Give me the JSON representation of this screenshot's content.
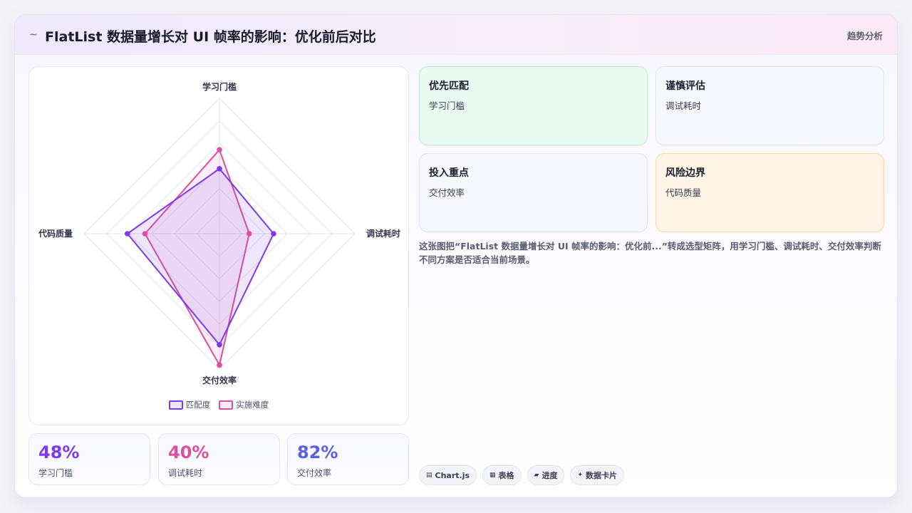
{
  "header": {
    "logo_icon": "~",
    "title": "FlatList 数据量增长对 UI 帧率的影响：优化前后对比",
    "tag": "趋势分析"
  },
  "chart_data": {
    "type": "radar",
    "axes": [
      "学习门槛",
      "调试耗时",
      "交付效率",
      "代码质量"
    ],
    "rmax": 100,
    "rings": 6,
    "series": [
      {
        "name": "匹配度",
        "values": [
          48,
          40,
          82,
          68
        ],
        "stroke": "#7c3aed",
        "fill": "rgba(124,58,237,0.13)"
      },
      {
        "name": "实施难度",
        "values": [
          62,
          22,
          97,
          55
        ],
        "stroke": "#db4f9f",
        "fill": "rgba(219,79,159,0.10)"
      }
    ]
  },
  "stats": [
    {
      "value": "48%",
      "label": "学习门槛",
      "color": "#7c3aed"
    },
    {
      "value": "40%",
      "label": "调试耗时",
      "color": "#db4f9f"
    },
    {
      "value": "82%",
      "label": "交付效率",
      "color": "#5b5fe0"
    }
  ],
  "quadrants": [
    {
      "title": "优先匹配",
      "sub": "学习门槛"
    },
    {
      "title": "谨慎评估",
      "sub": "调试耗时"
    },
    {
      "title": "投入重点",
      "sub": "交付效率"
    },
    {
      "title": "风险边界",
      "sub": "代码质量"
    }
  ],
  "description": "这张图把“FlatList 数据量增长对 UI 帧率的影响：优化前...”转成选型矩阵，用学习门槛、调试耗时、交付效率判断不同方案是否适合当前场景。",
  "chips": [
    {
      "icon": "▤",
      "label": "Chart.js"
    },
    {
      "icon": "▦",
      "label": "表格"
    },
    {
      "icon": "▰",
      "label": "进度"
    },
    {
      "icon": "✦",
      "label": "数据卡片"
    }
  ],
  "colors": {
    "accent_purple": "#7c3aed",
    "accent_pink": "#db4f9f",
    "accent_indigo": "#5b5fe0",
    "quad_green_bg": "#e9fbf1",
    "quad_green_border": "#b8ecd0",
    "quad_orange_bg": "#fff4e6",
    "quad_orange_border": "#f6d6a6",
    "quad_neutral_bg": "#f7f8fd",
    "quad_neutral_border": "#e1e5f0"
  }
}
